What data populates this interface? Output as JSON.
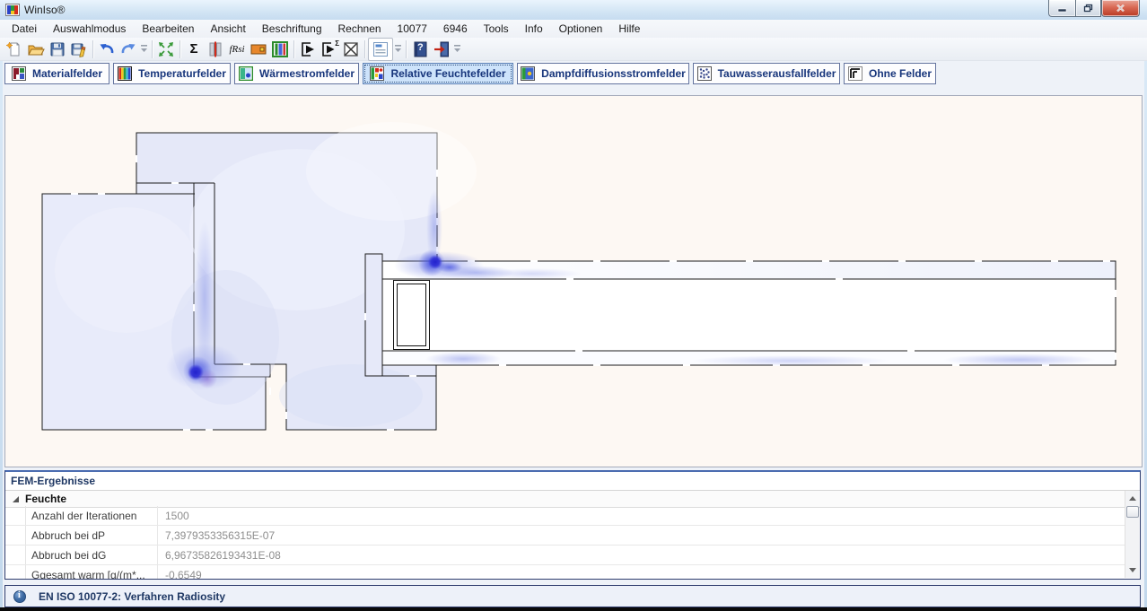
{
  "window": {
    "title": "WinIso®"
  },
  "menu": {
    "items": [
      "Datei",
      "Auswahlmodus",
      "Bearbeiten",
      "Ansicht",
      "Beschriftung",
      "Rechnen",
      "10077",
      "6946",
      "Tools",
      "Info",
      "Optionen",
      "Hilfe"
    ]
  },
  "toolbar": {
    "sigma_glyph": "Σ",
    "frsi_glyph": "fRsi",
    "help_glyph": "?",
    "icons": [
      "new-document",
      "open-folder",
      "save",
      "save-as",
      "undo",
      "redo",
      "zoom-extents",
      "sum",
      "beam-section",
      "frsi-factor",
      "material-block",
      "layer-fields",
      "run-calculation",
      "run-calculation-sum",
      "cancel-calculation",
      "report-list",
      "help-book",
      "exit-door"
    ]
  },
  "field_tabs": {
    "items": [
      {
        "label": "Materialfelder",
        "selected": false
      },
      {
        "label": "Temperaturfelder",
        "selected": false
      },
      {
        "label": "Wärmestromfelder",
        "selected": false
      },
      {
        "label": "Relative Feuchtefelder",
        "selected": true
      },
      {
        "label": "Dampfdiffusionsstromfelder",
        "selected": false
      },
      {
        "label": "Tauwasserausfallfelder",
        "selected": false
      },
      {
        "label": "Ohne Felder",
        "selected": false
      }
    ]
  },
  "fem": {
    "title": "FEM-Ergebnisse",
    "group": "Feuchte",
    "rows": [
      {
        "label": "Anzahl der Iterationen",
        "value": "1500"
      },
      {
        "label": "Abbruch bei dP",
        "value": "7,3979353356315E-07"
      },
      {
        "label": "Abbruch bei dG",
        "value": "6,96735826193431E-08"
      },
      {
        "label": "Ggesamt warm [g/(m*...",
        "value": "-0,6549"
      }
    ]
  },
  "status": {
    "info_glyph": "i",
    "text": "EN ISO 10077-2: Verfahren Radiosity"
  },
  "colors": {
    "selected_tab_bg": "#cde3fb",
    "tab_text": "#17357b",
    "field_fill": "#e5e8f8",
    "blob_blue": "#2d2dd4",
    "canvas_bg": "#fdf8f3",
    "panel_border": "#2f3d6e"
  }
}
